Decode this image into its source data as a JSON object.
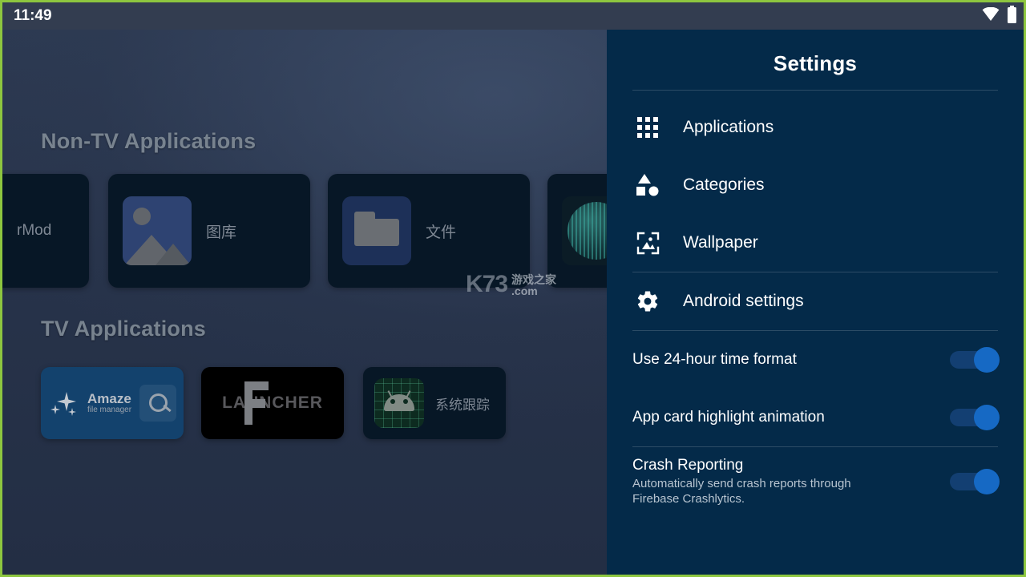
{
  "status_bar": {
    "clock": "11:49",
    "icons": [
      {
        "name": "wifi-icon",
        "glyph": "wifi"
      },
      {
        "name": "battery-icon",
        "glyph": "battery-full"
      }
    ]
  },
  "launcher": {
    "sections": [
      {
        "title": "Non-TV Applications"
      },
      {
        "title": "TV Applications"
      }
    ],
    "non_tv_apps": [
      {
        "label": "rMod",
        "icon": "partial-card-icon"
      },
      {
        "label": "图库",
        "icon": "gallery-icon"
      },
      {
        "label": "文件",
        "icon": "files-folder-icon"
      },
      {
        "label": "",
        "icon": "globe-icon"
      }
    ],
    "tv_apps": [
      {
        "label": "Amaze",
        "sublabel": "file manager",
        "icon": "amaze-file-manager-icon"
      },
      {
        "label": "LAUNCHER",
        "icon": "launcher-logo-icon"
      },
      {
        "label": "系统跟踪",
        "icon": "android-system-tracing-icon"
      }
    ],
    "watermark": {
      "k73": "K73",
      "chinese": "游戏之家",
      "com": ".com"
    }
  },
  "settings": {
    "title": "Settings",
    "menu_items": [
      {
        "label": "Applications",
        "icon": "apps-grid-icon"
      },
      {
        "label": "Categories",
        "icon": "shapes-icon"
      },
      {
        "label": "Wallpaper",
        "icon": "wallpaper-image-icon"
      }
    ],
    "android_settings": {
      "label": "Android settings",
      "icon": "gear-icon"
    },
    "toggles": [
      {
        "title": "Use 24-hour time format",
        "subtitle": "",
        "on": true
      },
      {
        "title": "App card highlight animation",
        "subtitle": "",
        "on": true
      },
      {
        "title": "Crash Reporting",
        "subtitle": "Automatically send crash reports through Firebase Crashlytics.",
        "on": true
      }
    ]
  },
  "colors": {
    "panel_bg": "#042a49",
    "accent_blue": "#1669c4",
    "track_blue": "#133f72",
    "statusbar_bg": "#333d50",
    "screen_border": "#8dc63f",
    "launcher_bg": "#27334a"
  }
}
